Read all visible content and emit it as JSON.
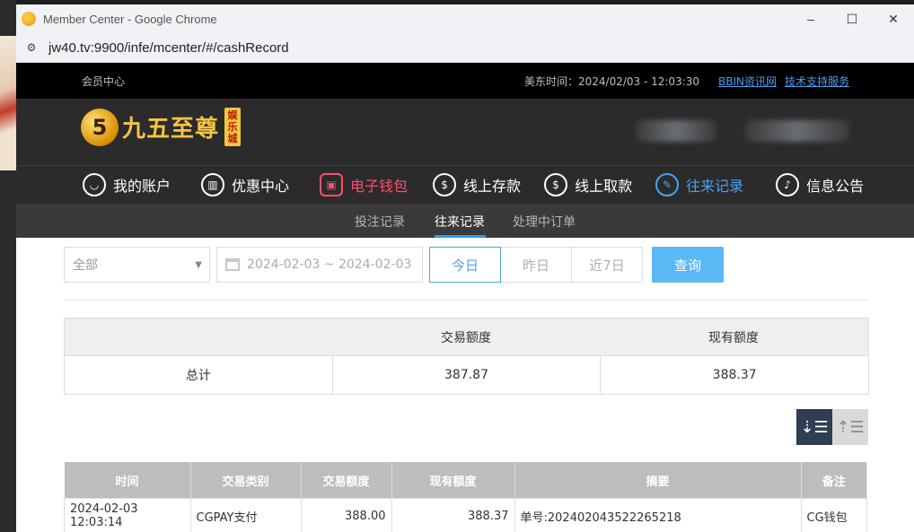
{
  "browser": {
    "title": "Member Center - Google Chrome",
    "url": "jw40.tv:9900/infe/mcenter/#/cashRecord",
    "controls": {
      "minimize": "–",
      "maximize": "☐",
      "close": "✕"
    }
  },
  "topbar": {
    "member_center": "会员中心",
    "time_text": "美东时间：2024/02/03 - 12:03:30",
    "links": [
      "BBIN资讯网",
      "技术支持服务"
    ]
  },
  "logo": {
    "mark": "5",
    "name": "九五至尊",
    "tag": "娱乐城"
  },
  "nav": {
    "items": [
      {
        "label": "我的账户",
        "icon": "user-icon"
      },
      {
        "label": "优惠中心",
        "icon": "gift-icon"
      },
      {
        "label": "电子钱包",
        "icon": "wallet-icon"
      },
      {
        "label": "线上存款",
        "icon": "deposit-icon"
      },
      {
        "label": "线上取款",
        "icon": "withdraw-icon"
      },
      {
        "label": "往来记录",
        "icon": "record-icon"
      },
      {
        "label": "信息公告",
        "icon": "bell-icon"
      }
    ],
    "colors": {
      "wallet": "#ff4f6a",
      "record": "#4aa3f0",
      "default": "#ffffff"
    }
  },
  "subnav": {
    "items": [
      "投注记录",
      "往来记录",
      "处理中订单"
    ],
    "active": "往来记录"
  },
  "filter": {
    "type_value": "全部",
    "date_range": "2024-02-03 ~ 2024-02-03",
    "quick": [
      "今日",
      "昨日",
      "近7日"
    ],
    "quick_selected": "今日",
    "query_label": "查询"
  },
  "summary": {
    "headers": [
      "",
      "交易额度",
      "现有额度"
    ],
    "row": [
      "总计",
      "387.87",
      "388.37"
    ]
  },
  "records": {
    "headers": [
      "时间",
      "交易类别",
      "交易额度",
      "现有额度",
      "摘要",
      "备注"
    ],
    "rows": [
      [
        "2024-02-03 12:03:14",
        "CGPAY支付",
        "388.00",
        "388.37",
        "单号:202402043522265218",
        "CG钱包"
      ]
    ]
  }
}
